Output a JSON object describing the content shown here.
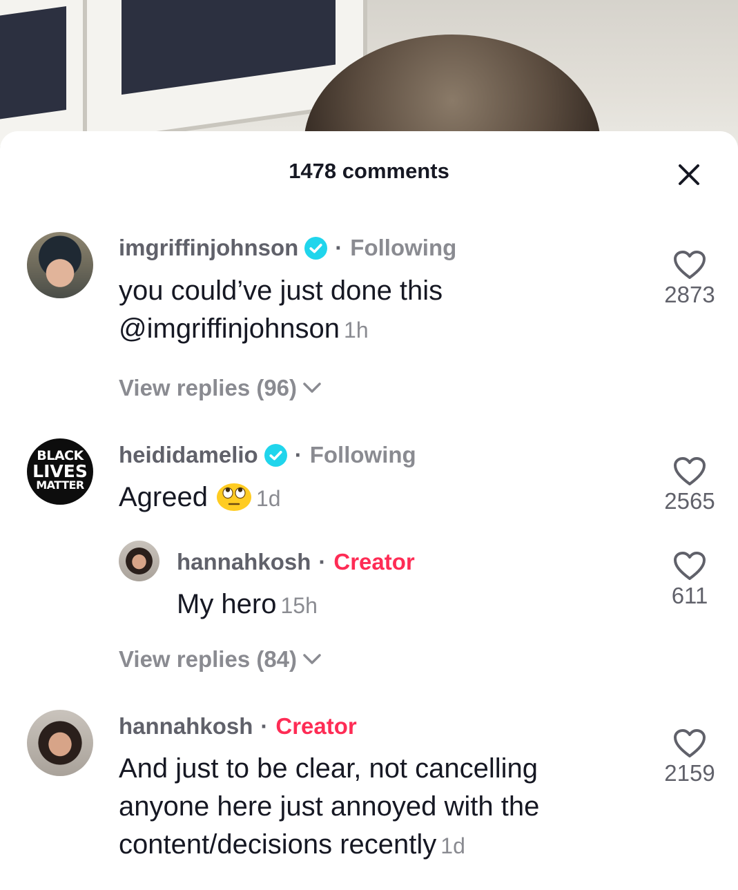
{
  "sheet": {
    "title": "1478 comments"
  },
  "icons": {
    "close": "close-icon",
    "like": "heart-outline-icon",
    "verified": "verified-badge-icon",
    "chevron": "chevron-down-icon",
    "emoji": "face-with-rolling-eyes-emoji"
  },
  "colors": {
    "creator": "#fe2c55",
    "verified": "#20d5ec",
    "text_primary": "#161823",
    "text_secondary": "#8a8b91"
  },
  "comments": [
    {
      "username": "imgriffinjohnson",
      "separator": "·",
      "relation": "Following",
      "line1": "you could’ve just done this",
      "line2": "@imgriffinjohnson",
      "time": "1h",
      "likes": "2873",
      "view_replies": "View replies (96)"
    },
    {
      "username": "heididamelio",
      "separator": "·",
      "relation": "Following",
      "avatar_text": [
        "BLACK",
        "LIVES",
        "MATTER"
      ],
      "text": "Agreed",
      "time": "1d",
      "likes": "2565",
      "reply": {
        "username": "hannahkosh",
        "separator": "·",
        "badge": "Creator",
        "text": "My hero",
        "time": "15h",
        "likes": "611"
      },
      "view_replies": "View replies (84)"
    },
    {
      "username": "hannahkosh",
      "separator": "·",
      "badge": "Creator",
      "line1": "And just to be clear, not cancelling",
      "line2": "anyone here just annoyed with the",
      "line3": "content/decisions recently",
      "time": "1d",
      "likes": "2159"
    }
  ]
}
